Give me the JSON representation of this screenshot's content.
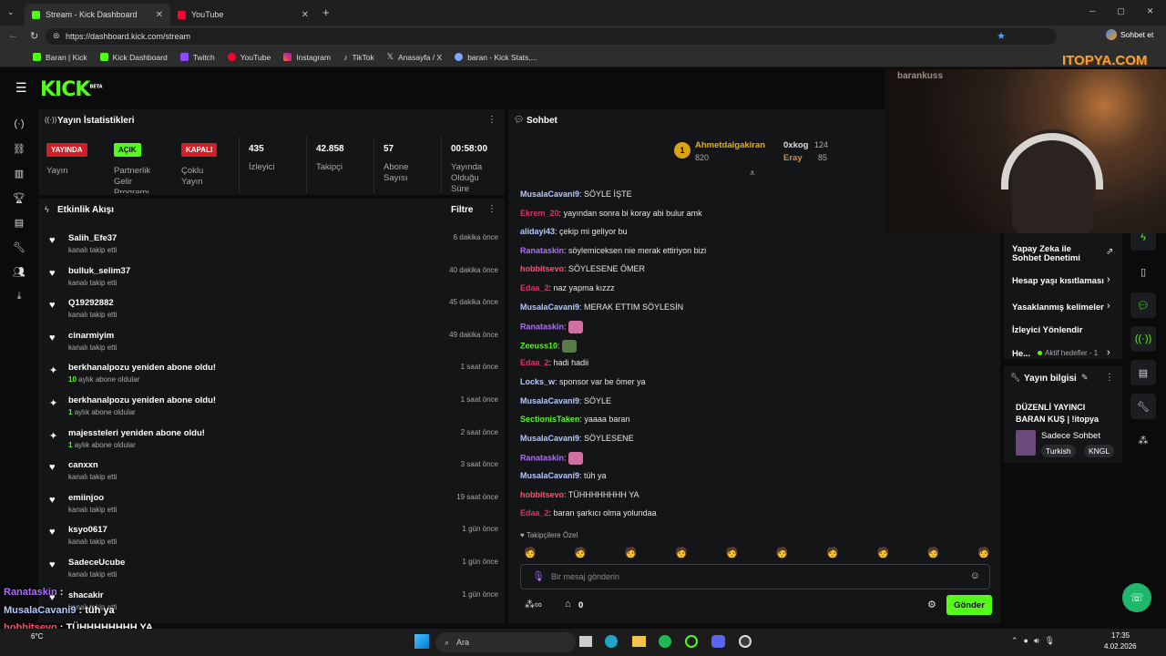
{
  "browser": {
    "tabs": [
      {
        "title": "Stream - Kick Dashboard"
      },
      {
        "title": "YouTube"
      }
    ],
    "url": "https://dashboard.kick.com/stream",
    "bookmarks": [
      "Baran | Kick",
      "Kick Dashboard",
      "Twitch",
      "YouTube",
      "Instagram",
      "TikTok",
      "Anasayfa / X",
      "baran - Kick Stats,..."
    ],
    "copilot_label": "Sohbet et"
  },
  "watermark": "ITOPYA.COM",
  "cam_name": "barankuss",
  "stats": {
    "title": "Yayın İstatistikleri",
    "badges": [
      {
        "value": "YAYINDA",
        "label": "Yayın",
        "color": "#d21f26"
      },
      {
        "value": "AÇIK",
        "label": "Partnerlik Gelir Programı",
        "color": "#53fc18"
      },
      {
        "value": "KAPALI",
        "label": "Çoklu Yayın",
        "color": "#d21f26"
      }
    ],
    "numbers": [
      {
        "value": "435",
        "label": "İzleyici"
      },
      {
        "value": "42.858",
        "label": "Takipçi"
      },
      {
        "value": "57",
        "label": "Abone Sayısı"
      },
      {
        "value": "00:58:00",
        "label": "Yayında Olduğu Süre"
      }
    ]
  },
  "activity": {
    "title": "Etkinlik Akışı",
    "filter": "Filtre",
    "items": [
      {
        "name": "Salih_Efe37",
        "sub": "kanalı takip etti",
        "time": "6 dakika önce",
        "icon": "heart"
      },
      {
        "name": "bulluk_selim37",
        "sub": "kanalı takip etti",
        "time": "40 dakika önce",
        "icon": "heart"
      },
      {
        "name": "Q19292882",
        "sub": "kanalı takip etti",
        "time": "45 dakika önce",
        "icon": "heart"
      },
      {
        "name": "cinarmiyim",
        "sub": "kanalı takip etti",
        "time": "49 dakika önce",
        "icon": "heart"
      },
      {
        "name": "berkhanalpozu yeniden abone oldu!",
        "sub_num": "10",
        "sub": "aylık abone oldular",
        "time": "1 saat önce",
        "icon": "sparkle"
      },
      {
        "name": "berkhanalpozu yeniden abone oldu!",
        "sub_num": "1",
        "sub": "aylık abone oldular",
        "time": "1 saat önce",
        "icon": "sparkle"
      },
      {
        "name": "majessteleri yeniden abone oldu!",
        "sub_num": "1",
        "sub": "aylık abone oldular",
        "time": "2 saat önce",
        "icon": "sparkle"
      },
      {
        "name": "canxxn",
        "sub": "kanalı takip etti",
        "time": "3 saat önce",
        "icon": "heart"
      },
      {
        "name": "emiinjoo",
        "sub": "kanalı takip etti",
        "time": "19 saat önce",
        "icon": "heart"
      },
      {
        "name": "ksyo0617",
        "sub": "kanalı takip etti",
        "time": "1 gün önce",
        "icon": "heart"
      },
      {
        "name": "SadeceUcube",
        "sub": "kanalı takip etti",
        "time": "1 gün önce",
        "icon": "heart"
      },
      {
        "name": "shacakir",
        "sub": "kanalı takip etti",
        "time": "1 gün önce",
        "icon": "heart"
      }
    ]
  },
  "chat": {
    "title": "Sohbet",
    "leaders": [
      {
        "rank": "1",
        "name": "Ahmetdalgakiran",
        "score": "820"
      },
      {
        "name": "0xkog",
        "score": "124"
      },
      {
        "name": "Eray",
        "score": "85"
      }
    ],
    "messages": [
      {
        "user": "MusalaCavani9",
        "color": "#b7c7ff",
        "text": "SÖYLE İŞTE"
      },
      {
        "user": "Ekrem_20",
        "color": "#d6336c",
        "text": "yayından sonra bi koray abi bulur amk"
      },
      {
        "user": "alidayi43",
        "color": "#b7c7ff",
        "text": "çekip mi geliyor bu"
      },
      {
        "user": "Ranataskin",
        "color": "#b36bff",
        "text": "söylemiceksen nie merak ettiriyon bizi"
      },
      {
        "user": "hobbitsevo",
        "color": "#ff4d6d",
        "text": "SÖYLESENE ÖMER"
      },
      {
        "user": "Edaa_2",
        "color": "#d6336c",
        "text": "naz yapma kızzz"
      },
      {
        "user": "MusalaCavani9",
        "color": "#b7c7ff",
        "text": "MERAK ETTIM SÖYLESİN"
      },
      {
        "user": "Ranataskin",
        "color": "#b36bff",
        "text": ""
      },
      {
        "user": "Zeeuss10",
        "color": "#53fc18",
        "text": ""
      },
      {
        "user": "Edaa_2",
        "color": "#d6336c",
        "text": "hadi hadii"
      },
      {
        "user": "Locks_w",
        "color": "#b7c7ff",
        "text": "sponsor var be ömer ya"
      },
      {
        "user": "MusalaCavani9",
        "color": "#b7c7ff",
        "text": "SÖYLE"
      },
      {
        "user": "SectionisTaken",
        "color": "#53fc18",
        "text": "yaaaa baran"
      },
      {
        "user": "MusalaCavani9",
        "color": "#b7c7ff",
        "text": "SÖYLESENE"
      },
      {
        "user": "Ranataskin",
        "color": "#b36bff",
        "text": ""
      },
      {
        "user": "MusalaCavani9",
        "color": "#b7c7ff",
        "text": "tüh ya"
      },
      {
        "user": "hobbitsevo",
        "color": "#ff4d6d",
        "text": "TÜHHHHHHHH YA"
      },
      {
        "user": "Edaa_2",
        "color": "#d6336c",
        "text": "baran şarkıcı olma yolundaa"
      }
    ],
    "followers_only": "Takipçilere Özel",
    "input_placeholder": "Bir mesaj gönderin",
    "points": "0",
    "send": "Gönder"
  },
  "right_panel": {
    "items": [
      "Yapay Zeka ile Sohbet Denetimi",
      "Hesap yaşı kısıtlaması",
      "Yasaklanmış kelimeler",
      "İzleyici Yönlendir"
    ],
    "goals_short": "He...",
    "goals_status": "Aktif hedefler - 1",
    "stream_info_title": "Yayın bilgisi",
    "stream_title": "DÜZENLİ YAYINCI BARAN KUŞ | !itopya",
    "category": "Sadece Sohbet",
    "tags": [
      "Turkish",
      "KNGL"
    ]
  },
  "overlay": [
    {
      "user": "Ranataskin",
      "text": ""
    },
    {
      "user": "MusalaCavani9",
      "text": "tüh ya"
    },
    {
      "user": "hobbitsevo",
      "text": "TÜHHHHHHHH YA"
    },
    {
      "user": "Edaa_2",
      "text": "baran şarkıcı olma yolundaa"
    }
  ],
  "taskbar": {
    "search": "Ara",
    "time": "17:35",
    "date": "4.02.2026",
    "weather": "6°C"
  },
  "colors": {
    "accent": "#53fc18",
    "live": "#d21f26"
  }
}
